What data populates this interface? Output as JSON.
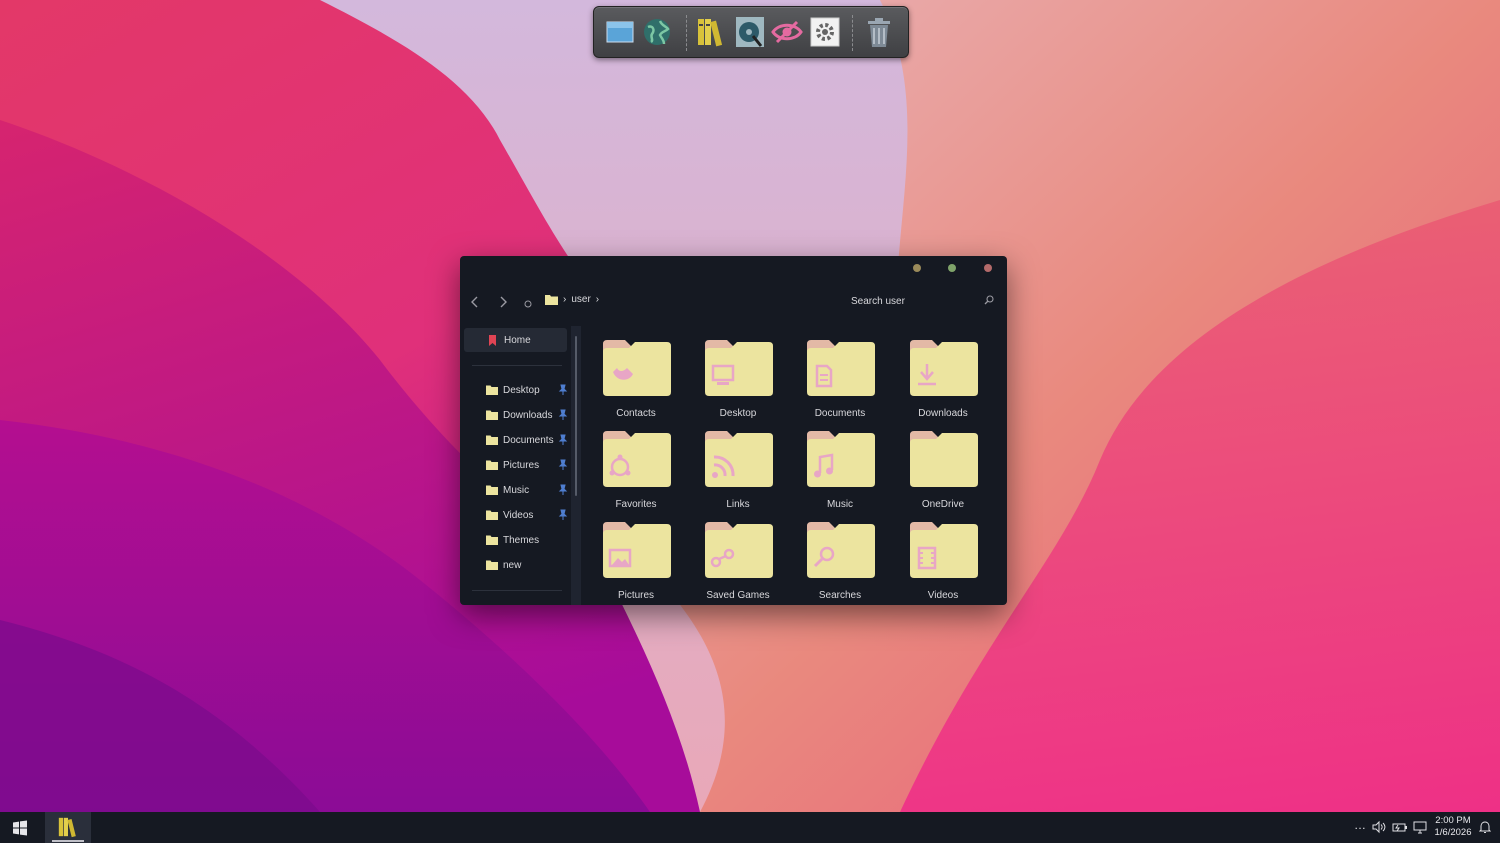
{
  "dock": {
    "icons": [
      "desktop-icon",
      "globe-icon",
      "library-icon",
      "disk-utility-icon",
      "eye-icon",
      "settings-gear-icon",
      "trash-icon"
    ]
  },
  "explorer": {
    "breadcrumb": {
      "segment": "user",
      "chevron": "›"
    },
    "search_placeholder": "Search user",
    "sidebar": {
      "home_label": "Home",
      "items": [
        {
          "label": "Desktop",
          "pinned": true
        },
        {
          "label": "Downloads",
          "pinned": true
        },
        {
          "label": "Documents",
          "pinned": true
        },
        {
          "label": "Pictures",
          "pinned": true
        },
        {
          "label": "Music",
          "pinned": true
        },
        {
          "label": "Videos",
          "pinned": true
        },
        {
          "label": "Themes",
          "pinned": false
        },
        {
          "label": "new",
          "pinned": false
        }
      ]
    },
    "folders": [
      {
        "label": "Contacts",
        "glyph": "contacts"
      },
      {
        "label": "Desktop",
        "glyph": "desktop"
      },
      {
        "label": "Documents",
        "glyph": "documents"
      },
      {
        "label": "Downloads",
        "glyph": "downloads"
      },
      {
        "label": "Favorites",
        "glyph": "favorites"
      },
      {
        "label": "Links",
        "glyph": "links"
      },
      {
        "label": "Music",
        "glyph": "music"
      },
      {
        "label": "OneDrive",
        "glyph": "none"
      },
      {
        "label": "Pictures",
        "glyph": "pictures"
      },
      {
        "label": "Saved Games",
        "glyph": "games"
      },
      {
        "label": "Searches",
        "glyph": "searches"
      },
      {
        "label": "Videos",
        "glyph": "videos"
      }
    ]
  },
  "taskbar": {
    "clock_time": "2:00 PM",
    "clock_date": "1/6/2026",
    "overflow": "…"
  },
  "colors": {
    "folder_body": "#ece49f",
    "folder_tab": "#e3b9a6",
    "folder_glyph": "#e8a6c6",
    "window_bg": "#151922",
    "taskbar_bg": "#151922"
  }
}
